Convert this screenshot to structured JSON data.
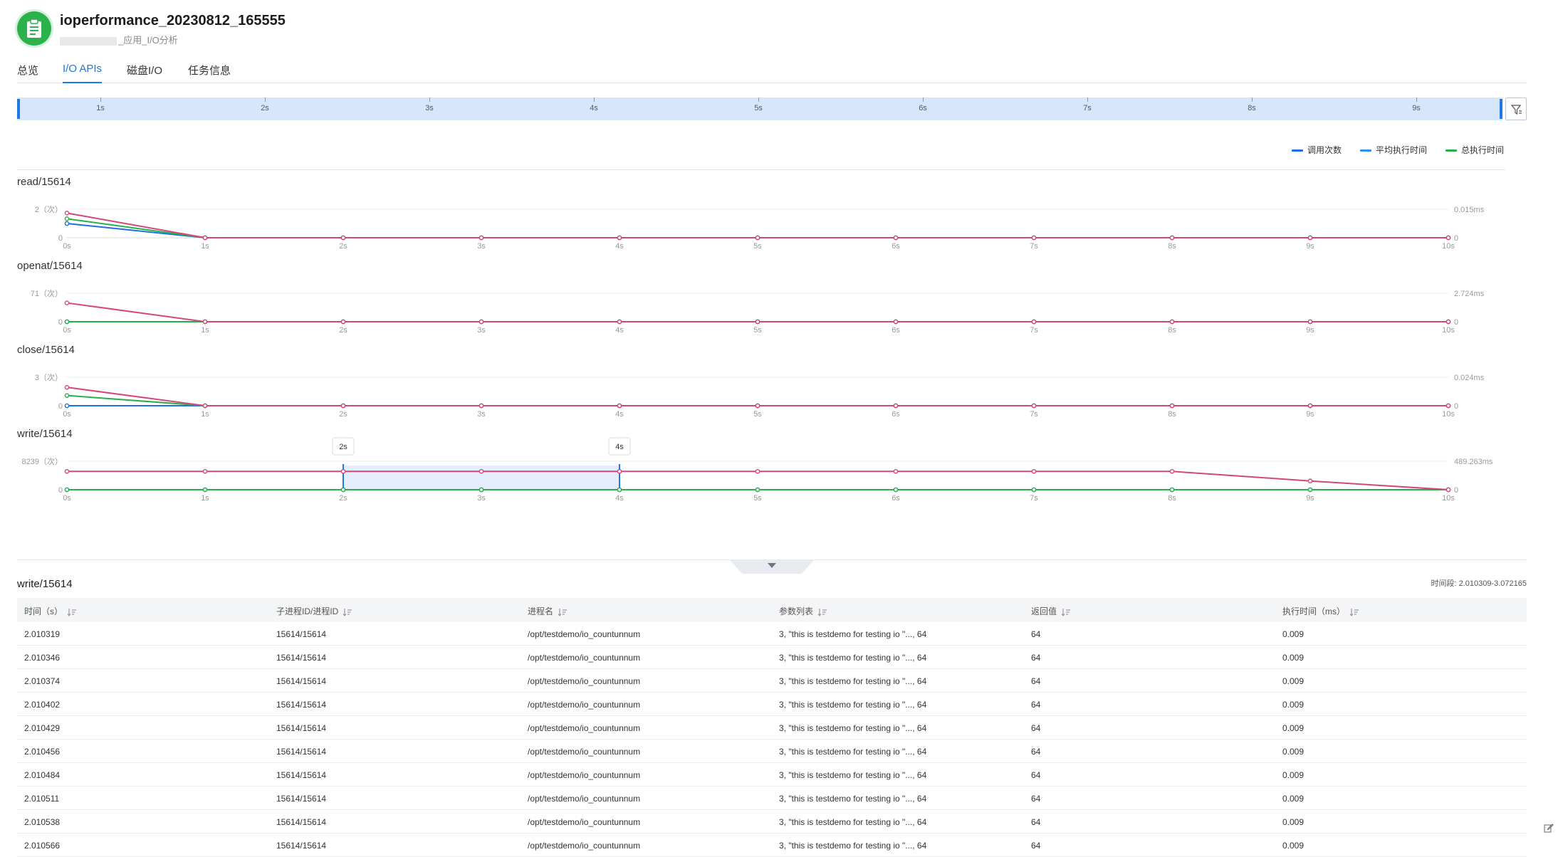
{
  "header": {
    "title": "ioperformance_20230812_165555",
    "subtitle": "_应用_I/O分析"
  },
  "tabs": [
    {
      "label": "总览",
      "active": false
    },
    {
      "label": "I/O APIs",
      "active": true
    },
    {
      "label": "磁盘I/O",
      "active": false
    },
    {
      "label": "任务信息",
      "active": false
    }
  ],
  "timeline": {
    "ticks": [
      "1s",
      "2s",
      "3s",
      "4s",
      "5s",
      "6s",
      "7s",
      "8s",
      "9s"
    ]
  },
  "legend": [
    {
      "label": "调用次数",
      "color": "#1f6fe0"
    },
    {
      "label": "平均执行时间",
      "color": "#2f8fe6"
    },
    {
      "label": "总执行时间",
      "color": "#26b04a"
    }
  ],
  "colors": {
    "accent": "#1f78e6",
    "calls": "#1f6fe0",
    "avg_time": "#d2477c",
    "total_time": "#26b04a",
    "selection": "#e3edfc"
  },
  "chart_data": [
    {
      "type": "line",
      "title": "read/15614",
      "x": [
        0,
        1,
        2,
        3,
        4,
        5,
        6,
        7,
        8,
        9,
        10
      ],
      "x_tick_labels": [
        "0s",
        "1s",
        "2s",
        "3s",
        "4s",
        "5s",
        "6s",
        "7s",
        "8s",
        "9s",
        "10s"
      ],
      "y_left_ticks": [
        "2（次）",
        "0"
      ],
      "y_left_max": 2,
      "y_right_ticks": [
        "0.015ms",
        "0"
      ],
      "y_right_max": 0.015,
      "series": [
        {
          "name": "调用次数",
          "axis": "left",
          "values": [
            1,
            0,
            0,
            0,
            0,
            0,
            0,
            0,
            0,
            0,
            0
          ]
        },
        {
          "name": "总执行时间",
          "axis": "right",
          "values": [
            0.01,
            0,
            0,
            0,
            0,
            0,
            0,
            0,
            0,
            0,
            0
          ]
        },
        {
          "name": "平均执行时间",
          "axis": "right",
          "values": [
            0.013,
            0,
            0,
            0,
            0,
            0,
            0,
            0,
            0,
            0,
            0
          ]
        }
      ]
    },
    {
      "type": "line",
      "title": "openat/15614",
      "x": [
        0,
        1,
        2,
        3,
        4,
        5,
        6,
        7,
        8,
        9,
        10
      ],
      "x_tick_labels": [
        "0s",
        "1s",
        "2s",
        "3s",
        "4s",
        "5s",
        "6s",
        "7s",
        "8s",
        "9s",
        "10s"
      ],
      "y_left_ticks": [
        "71（次）",
        "0"
      ],
      "y_left_max": 71,
      "y_right_ticks": [
        "2.724ms",
        "0"
      ],
      "y_right_max": 2.724,
      "series": [
        {
          "name": "调用次数",
          "axis": "left",
          "values": [
            0,
            0,
            0,
            0,
            0,
            0,
            0,
            0,
            0,
            0,
            0
          ]
        },
        {
          "name": "总执行时间",
          "axis": "right",
          "values": [
            0,
            0,
            0,
            0,
            0,
            0,
            0,
            0,
            0,
            0,
            0
          ]
        },
        {
          "name": "平均执行时间",
          "axis": "right",
          "values": [
            1.8,
            0,
            0,
            0,
            0,
            0,
            0,
            0,
            0,
            0,
            0
          ]
        }
      ]
    },
    {
      "type": "line",
      "title": "close/15614",
      "x": [
        0,
        1,
        2,
        3,
        4,
        5,
        6,
        7,
        8,
        9,
        10
      ],
      "x_tick_labels": [
        "0s",
        "1s",
        "2s",
        "3s",
        "4s",
        "5s",
        "6s",
        "7s",
        "8s",
        "9s",
        "10s"
      ],
      "y_left_ticks": [
        "3（次）",
        "0"
      ],
      "y_left_max": 3,
      "y_right_ticks": [
        "0.024ms",
        "0"
      ],
      "y_right_max": 0.024,
      "series": [
        {
          "name": "调用次数",
          "axis": "left",
          "values": [
            0,
            0,
            0,
            0,
            0,
            0,
            0,
            0,
            0,
            0,
            0
          ]
        },
        {
          "name": "总执行时间",
          "axis": "right",
          "values": [
            0.0086,
            0,
            0,
            0,
            0,
            0,
            0,
            0,
            0,
            0,
            0
          ]
        },
        {
          "name": "平均执行时间",
          "axis": "right",
          "values": [
            0.0155,
            0,
            0,
            0,
            0,
            0,
            0,
            0,
            0,
            0,
            0
          ]
        }
      ]
    },
    {
      "type": "line",
      "title": "write/15614",
      "x": [
        0,
        1,
        2,
        3,
        4,
        5,
        6,
        7,
        8,
        9,
        10
      ],
      "x_tick_labels": [
        "0s",
        "1s",
        "2s",
        "3s",
        "4s",
        "5s",
        "6s",
        "7s",
        "8s",
        "9s",
        "10s"
      ],
      "y_left_ticks": [
        "8239（次）",
        "0"
      ],
      "y_left_max": 8239,
      "y_right_ticks": [
        "489.263ms",
        "0"
      ],
      "y_right_max": 489.263,
      "series": [
        {
          "name": "调用次数",
          "axis": "left",
          "values": [
            0,
            0,
            0,
            0,
            0,
            0,
            0,
            0,
            0,
            0,
            0
          ]
        },
        {
          "name": "总执行时间",
          "axis": "right",
          "values": [
            0,
            0,
            0,
            0,
            0,
            0,
            0,
            0,
            0,
            0,
            0
          ]
        },
        {
          "name": "平均执行时间",
          "axis": "right",
          "values": [
            315,
            315,
            315,
            315,
            315,
            315,
            315,
            315,
            315,
            150,
            0
          ]
        }
      ],
      "selection": {
        "start": 2,
        "end": 4,
        "start_label": "2s",
        "end_label": "4s"
      }
    }
  ],
  "detail": {
    "title": "write/15614",
    "time_range": "时间段: 2.010309-3.072165",
    "columns": [
      "时间（s）",
      "子进程ID/进程ID",
      "进程名",
      "参数列表",
      "返回值",
      "执行时间（ms）"
    ],
    "rows": [
      [
        "2.010319",
        "15614/15614",
        "/opt/testdemo/io_countunnum",
        "3, \"this is testdemo for testing io \"..., 64",
        "64",
        "0.009"
      ],
      [
        "2.010346",
        "15614/15614",
        "/opt/testdemo/io_countunnum",
        "3, \"this is testdemo for testing io \"..., 64",
        "64",
        "0.009"
      ],
      [
        "2.010374",
        "15614/15614",
        "/opt/testdemo/io_countunnum",
        "3, \"this is testdemo for testing io \"..., 64",
        "64",
        "0.009"
      ],
      [
        "2.010402",
        "15614/15614",
        "/opt/testdemo/io_countunnum",
        "3, \"this is testdemo for testing io \"..., 64",
        "64",
        "0.009"
      ],
      [
        "2.010429",
        "15614/15614",
        "/opt/testdemo/io_countunnum",
        "3, \"this is testdemo for testing io \"..., 64",
        "64",
        "0.009"
      ],
      [
        "2.010456",
        "15614/15614",
        "/opt/testdemo/io_countunnum",
        "3, \"this is testdemo for testing io \"..., 64",
        "64",
        "0.009"
      ],
      [
        "2.010484",
        "15614/15614",
        "/opt/testdemo/io_countunnum",
        "3, \"this is testdemo for testing io \"..., 64",
        "64",
        "0.009"
      ],
      [
        "2.010511",
        "15614/15614",
        "/opt/testdemo/io_countunnum",
        "3, \"this is testdemo for testing io \"..., 64",
        "64",
        "0.009"
      ],
      [
        "2.010538",
        "15614/15614",
        "/opt/testdemo/io_countunnum",
        "3, \"this is testdemo for testing io \"..., 64",
        "64",
        "0.009"
      ],
      [
        "2.010566",
        "15614/15614",
        "/opt/testdemo/io_countunnum",
        "3, \"this is testdemo for testing io \"..., 64",
        "64",
        "0.009"
      ]
    ]
  },
  "icons": {
    "task": "clipboard-icon",
    "filter": "filter-icon",
    "collapse": "chevron-down-icon",
    "sort": "sort-icon",
    "edit": "edit-icon"
  }
}
